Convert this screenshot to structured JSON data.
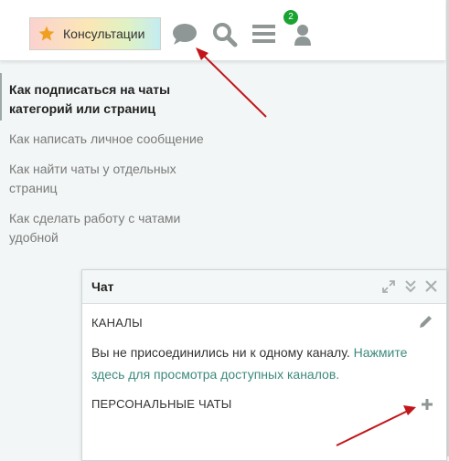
{
  "header": {
    "consult_label": "Консультации",
    "notification_count": "2",
    "icons": [
      "star-icon",
      "chat-bubble-icon",
      "search-icon",
      "hamburger-menu-icon",
      "user-icon"
    ]
  },
  "sidebar": {
    "items": [
      {
        "label": "Как подписаться на чаты категорий или страниц",
        "active": true
      },
      {
        "label": "Как написать личное сообщение",
        "active": false
      },
      {
        "label": "Как найти чаты у отдельных страниц",
        "active": false
      },
      {
        "label": "Как сделать работу с чатами удобной",
        "active": false
      }
    ]
  },
  "chat": {
    "title": "Чат",
    "channels_heading": "КАНАЛЫ",
    "no_channels_text": "Вы не присоединились ни к одному каналу.",
    "browse_link": "Нажмите здесь для просмотра доступных каналов.",
    "personal_heading": "ПЕРСОНАЛЬНЫЕ ЧАТЫ"
  },
  "colors": {
    "badge": "#19a331",
    "link": "#3c8a7d",
    "icon_gray": "#8f9696",
    "annotation_arrow": "#c0161b"
  }
}
